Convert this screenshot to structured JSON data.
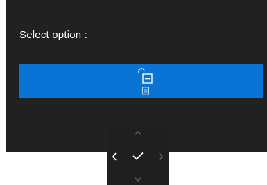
{
  "dialog": {
    "prompt": "Select option :",
    "option": {
      "icon": "unlock-icon",
      "secondary_icon": "menu-icon",
      "accent_color": "#0a74d6"
    }
  },
  "navigation": {
    "buttons": [
      "chevron-up-icon",
      "chevron-left-icon",
      "checkmark-icon",
      "chevron-right-icon",
      "chevron-down-icon"
    ],
    "disabled_color": "#6b6b6b",
    "enabled_color": "#ffffff"
  }
}
